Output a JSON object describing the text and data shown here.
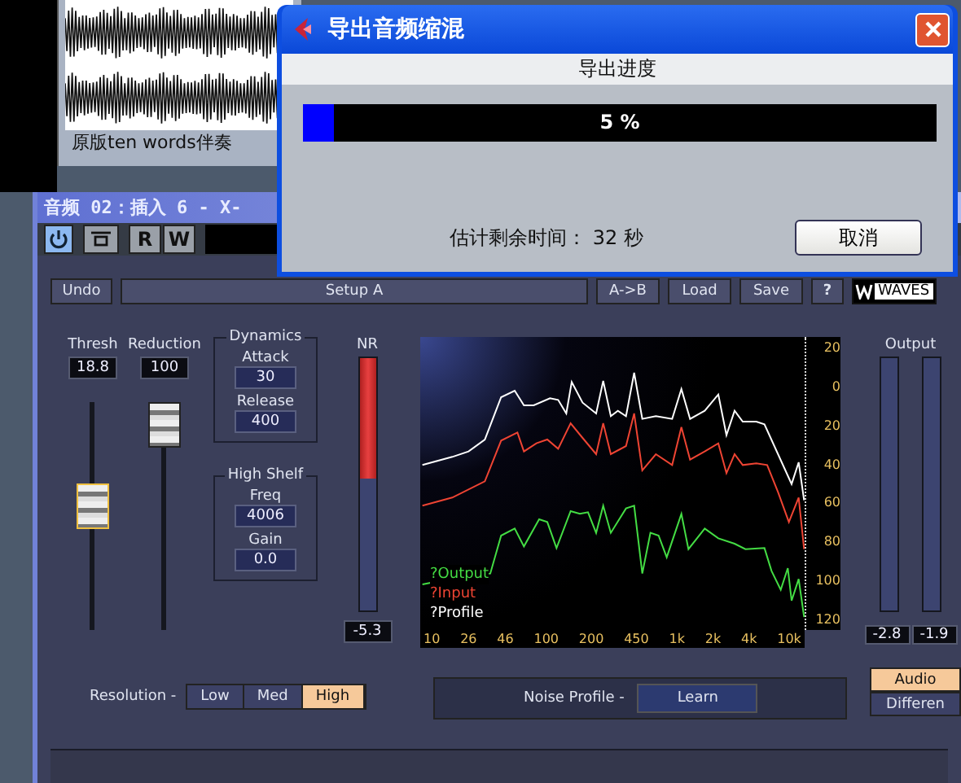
{
  "track": {
    "clip_label": "原版ten words伴奏"
  },
  "plugin_window": {
    "title": "音频 02：插入 6 - X-",
    "power": {
      "on": true
    },
    "rw_buttons": [
      "R",
      "W"
    ]
  },
  "header": {
    "undo": "Undo",
    "preset": "Setup A",
    "buttons": [
      "A->B",
      "Load",
      "Save",
      "?"
    ],
    "logo": "WAVES"
  },
  "faders": [
    {
      "label": "Thresh",
      "value": "18.8",
      "level": 0.55,
      "selected": true
    },
    {
      "label": "Reduction",
      "value": "100",
      "level": 1,
      "selected": false
    }
  ],
  "groups": [
    {
      "title": "Dynamics",
      "params": [
        {
          "label": "Attack",
          "value": "30"
        },
        {
          "label": "Release",
          "value": "400"
        }
      ]
    },
    {
      "title": "High Shelf",
      "params": [
        {
          "label": "Freq",
          "value": "4006"
        },
        {
          "label": "Gain",
          "value": "0.0"
        }
      ]
    }
  ],
  "nr_meter": {
    "label": "NR",
    "level": 0.48,
    "reading": "-5.3"
  },
  "spectrum": {
    "legend": [
      {
        "label": "?Output",
        "color": "#44dd44"
      },
      {
        "label": "?Input",
        "color": "#ee4433"
      },
      {
        "label": "?Profile",
        "color": "#ffffff"
      }
    ],
    "y_labels": [
      "20",
      "0",
      "20",
      "40",
      "60",
      "80",
      "100",
      "120"
    ],
    "x_labels": [
      "10",
      "26",
      "46",
      "100",
      "200",
      "450",
      "1k",
      "2k",
      "4k",
      "10k"
    ]
  },
  "output_meters": {
    "label": "Output",
    "readings": [
      "-2.8",
      "-1.9"
    ]
  },
  "resolution": {
    "label": "Resolution -",
    "options": [
      {
        "label": "Low",
        "selected": false
      },
      {
        "label": "Med",
        "selected": false
      },
      {
        "label": "High",
        "selected": true
      }
    ]
  },
  "noise_profile": {
    "label": "Noise Profile -",
    "button": "Learn"
  },
  "monitor": [
    {
      "label": "Audio",
      "selected": true
    },
    {
      "label": "Differen",
      "selected": false
    }
  ],
  "dialog": {
    "title": "导出音频缩混",
    "section": "导出进度",
    "progress": {
      "level": 0.05,
      "reading": "5 %"
    },
    "remaining": "估计剩余时间： 32 秒",
    "cancel": "取消"
  }
}
